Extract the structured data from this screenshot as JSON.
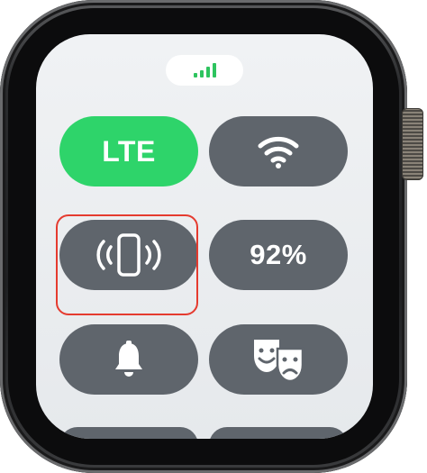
{
  "status": {
    "cellular_signal_icon": "cellular-signal-bars",
    "signal_bars": 4,
    "accent": "#2ec45f"
  },
  "controls": {
    "lte": {
      "label": "LTE",
      "state": "on",
      "color": "#2ed46a"
    },
    "wifi": {
      "icon": "wifi-icon"
    },
    "ping_iphone": {
      "icon": "ping-iphone-icon"
    },
    "battery": {
      "label": "92%"
    },
    "silent_mode": {
      "icon": "bell-icon"
    },
    "theater_mode": {
      "icon": "theater-masks-icon"
    }
  },
  "highlight": {
    "target": "ping-iphone-button",
    "color": "#e53b2f"
  }
}
